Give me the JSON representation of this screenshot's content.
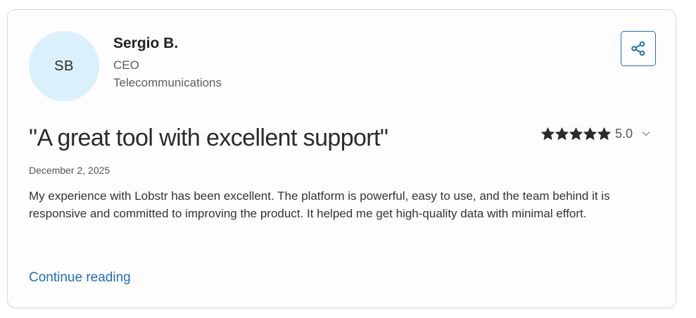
{
  "review": {
    "author": {
      "initials": "SB",
      "name": "Sergio B.",
      "role": "CEO",
      "industry": "Telecommunications"
    },
    "title": "\"A great tool with excellent support\"",
    "rating": {
      "stars_filled": 5,
      "stars_total": 5,
      "value_label": "5.0"
    },
    "date": "December 2, 2025",
    "body": "My experience with Lobstr has been excellent. The platform is powerful, easy to use, and the team behind it is responsive and committed to improving the product. It helped me get high-quality data with minimal effort.",
    "continue_label": "Continue reading"
  },
  "icons": {
    "share": "share-icon",
    "star": "star-icon",
    "chevron": "chevron-down-icon"
  },
  "colors": {
    "accent": "#1f6fb8",
    "avatar_bg": "#daf0fb",
    "star": "#2b2b2b"
  }
}
